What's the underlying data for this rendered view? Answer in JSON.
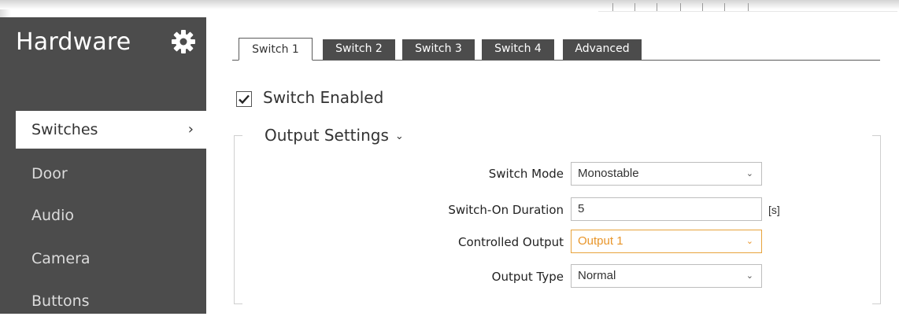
{
  "sidebar": {
    "title": "Hardware",
    "settings_icon": "gear-icon",
    "items": [
      {
        "label": "Switches",
        "active": true
      },
      {
        "label": "Door"
      },
      {
        "label": "Audio"
      },
      {
        "label": "Camera"
      },
      {
        "label": "Buttons"
      }
    ],
    "active_chevron": "›"
  },
  "tabs": [
    {
      "label": "Switch 1",
      "active": true
    },
    {
      "label": "Switch 2"
    },
    {
      "label": "Switch 3"
    },
    {
      "label": "Switch 4"
    },
    {
      "label": "Advanced"
    }
  ],
  "switch_enabled": {
    "label": "Switch Enabled",
    "checked": true
  },
  "output_settings": {
    "title": "Output Settings",
    "chevron": "⌄",
    "fields": {
      "switch_mode": {
        "label": "Switch Mode",
        "value": "Monostable"
      },
      "switch_on_duration": {
        "label": "Switch-On Duration",
        "value": "5",
        "unit": "[s]"
      },
      "controlled_output": {
        "label": "Controlled Output",
        "value": "Output 1"
      },
      "output_type": {
        "label": "Output Type",
        "value": "Normal"
      }
    },
    "dropdown_caret": "⌄"
  },
  "colors": {
    "sidebar_bg": "#4c4c4c",
    "highlight": "#e8952a"
  }
}
